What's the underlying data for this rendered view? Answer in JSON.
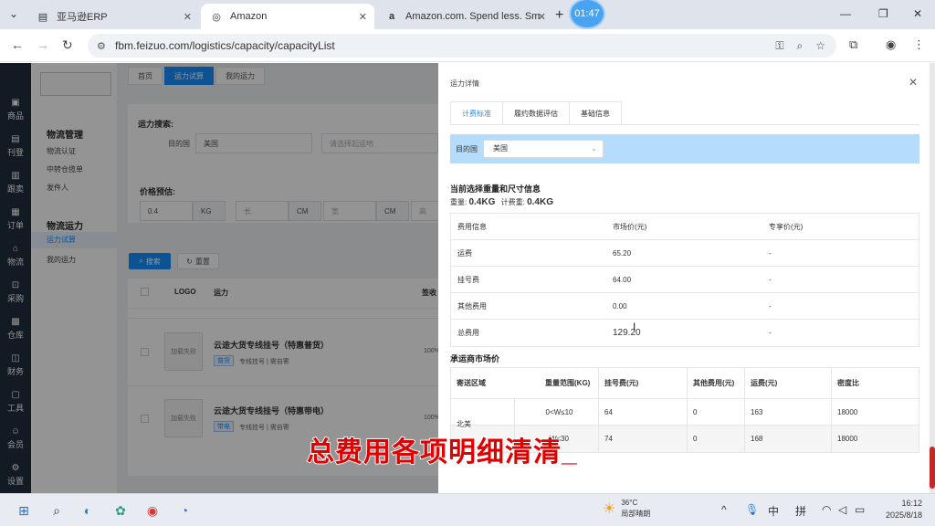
{
  "browser": {
    "tabs": [
      {
        "title": "亚马逊ERP",
        "icon": "tab-icon"
      },
      {
        "title": "Amazon",
        "icon": "globe-icon"
      },
      {
        "title": "Amazon.com. Spend less. Sm",
        "icon": "amazon-icon"
      }
    ],
    "clock_badge": "01:47",
    "url": "fbm.feizuo.com/logistics/capacity/capacityList"
  },
  "rail": {
    "items": [
      {
        "label": "商品",
        "icon": "box-icon"
      },
      {
        "label": "刊登",
        "icon": "publish-icon"
      },
      {
        "label": "跟卖",
        "icon": "follow-icon"
      },
      {
        "label": "订单",
        "icon": "order-icon"
      },
      {
        "label": "物流",
        "icon": "home-icon"
      },
      {
        "label": "采购",
        "icon": "cart-icon"
      },
      {
        "label": "仓库",
        "icon": "warehouse-icon"
      },
      {
        "label": "财务",
        "icon": "finance-icon"
      },
      {
        "label": "工具",
        "icon": "tool-icon"
      },
      {
        "label": "会员",
        "icon": "user-icon"
      },
      {
        "label": "设置",
        "icon": "gear-icon"
      }
    ]
  },
  "submenu": {
    "group1_title": "物流管理",
    "group1_items": [
      "物流认证",
      "中转仓揽单",
      "发件人"
    ],
    "group2_title": "物流运力",
    "group2_items": [
      "运力试算",
      "我的运力"
    ]
  },
  "page": {
    "tabs": [
      "首页",
      "运力试算",
      "我的运力"
    ],
    "search_label": "运力搜索:",
    "dest_label": "目的国",
    "dest_value": "美国",
    "carrier_placeholder": "请选择起运地",
    "price_label": "价格预估:",
    "weight_value": "0.4",
    "weight_unit": "KG",
    "length_ph": "长",
    "length_unit": "CM",
    "width_ph": "宽",
    "width_unit": "CM",
    "height_ph": "高",
    "search_btn": "搜索",
    "reset_btn": "重置",
    "col_logo": "LOGO",
    "col_capacity": "运力",
    "col_sign": "签收",
    "rows": [
      {
        "img": "加载失败",
        "title": "云途大货专线挂号（特惠普货）",
        "tag": "普货",
        "sub": "专线挂号 | 需自寄",
        "rate": "100%"
      },
      {
        "img": "加载失败",
        "title": "云途大货专线挂号（特惠带电）",
        "tag": "带电",
        "sub": "专线挂号 | 需自寄",
        "rate": "100%"
      }
    ]
  },
  "drawer": {
    "title": "运力详情",
    "tabs": [
      "计费标准",
      "履约数据评估",
      "基础信息"
    ],
    "dest_label": "目的国",
    "dest_value": "美国",
    "section1": "当前选择重量和尺寸信息",
    "weight_label": "重量:",
    "weight_value": "0.4KG",
    "charge_label": "计费重:",
    "charge_value": "0.4KG",
    "fee_table": {
      "headers": [
        "费用信息",
        "市场价(元)",
        "专享价(元)"
      ],
      "rows": [
        [
          "运费",
          "65.20",
          "-"
        ],
        [
          "挂号费",
          "64.00",
          "-"
        ],
        [
          "其他费用",
          "0.00",
          "-"
        ],
        [
          "总费用",
          "129.20",
          "-"
        ]
      ]
    },
    "section2": "承运商市场价",
    "carrier_table": {
      "headers": [
        "寄送区域",
        "重量范围(KG)",
        "挂号费(元)",
        "其他费用(元)",
        "运费(元)",
        "密度比"
      ],
      "region": "北美",
      "rows": [
        [
          "0<W≤10",
          "64",
          "0",
          "163",
          "18000"
        ],
        [
          "W≤30",
          "74",
          "0",
          "168",
          "18000"
        ]
      ]
    }
  },
  "subtitle": "总费用各项明细清清",
  "taskbar": {
    "temp": "36°C",
    "weather": "局部晴朗",
    "ime": "中",
    "ime2": "拼",
    "time": "16:12",
    "date": "2025/8/18"
  }
}
